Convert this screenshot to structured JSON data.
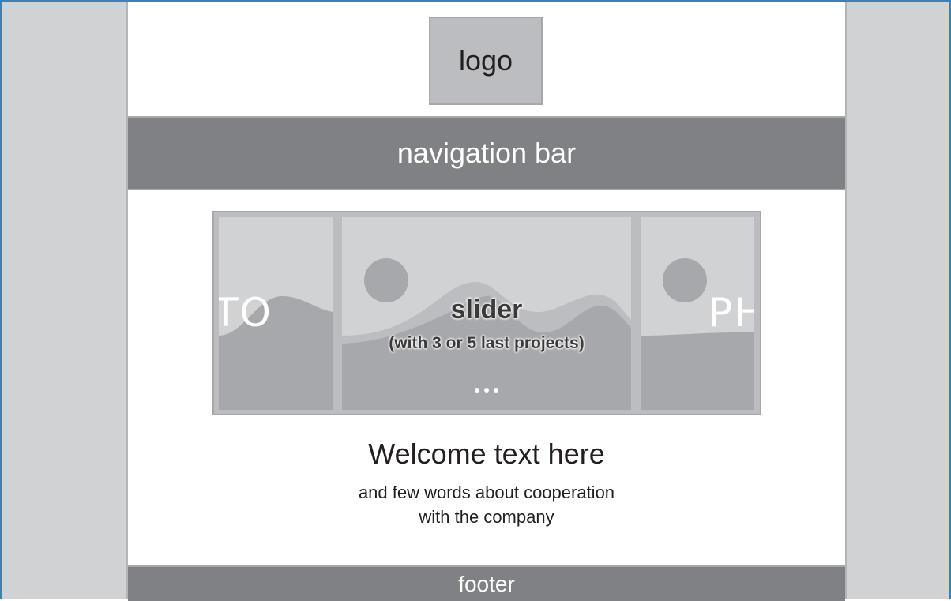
{
  "logo": {
    "label": "logo"
  },
  "navigation": {
    "label": "navigation bar"
  },
  "slider": {
    "title": "slider",
    "subtitle": "(with 3 or 5 last projects)",
    "left_slide_text": "TO",
    "right_slide_text": "PH",
    "dot_count": 3
  },
  "welcome": {
    "heading": "Welcome text here",
    "line1": "and few words about cooperation",
    "line2": "with the company"
  },
  "footer": {
    "label": "footer"
  },
  "colors": {
    "outer_background": "#d1d2d4",
    "page_background": "#ffffff",
    "bar_fill": "#808184",
    "placeholder_fill": "#bcbdc0",
    "image_mountain": "#a7a8ab",
    "frame_border": "#3f7fb8"
  }
}
